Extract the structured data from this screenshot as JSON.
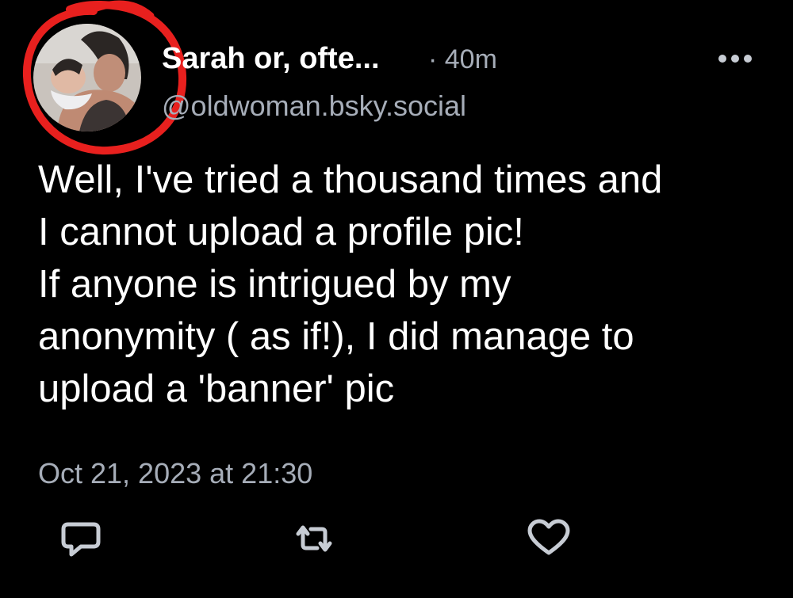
{
  "post": {
    "display_name": "Sarah or, ofte...",
    "time_ago": "· 40m",
    "handle": "@oldwoman.bsky.social",
    "text": "Well, I've tried a thousand times and\nI cannot upload a profile pic!\nIf anyone is intrigued by my\nanonymity ( as if!), I did manage to\nupload a 'banner' pic",
    "timestamp": "Oct 21, 2023 at 21:30"
  },
  "icons": {
    "more": "more-horizontal-icon",
    "reply": "speech-bubble-icon",
    "repost": "repost-arrows-icon",
    "like": "heart-icon"
  },
  "colors": {
    "background": "#000000",
    "text": "#ffffff",
    "muted": "#a6adb8",
    "annotation": "#e8201e"
  }
}
